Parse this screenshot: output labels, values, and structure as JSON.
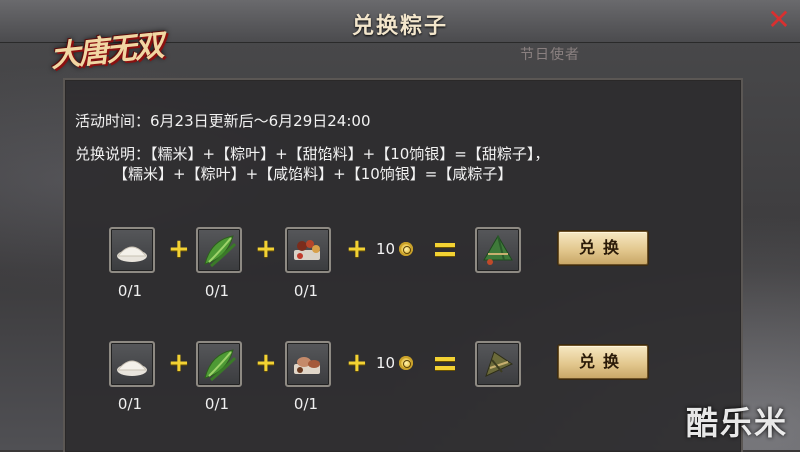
{
  "window": {
    "title": "兑换粽子",
    "close_glyph": "✕",
    "logo_text": "大唐无双",
    "npc_label": "节日使者"
  },
  "info": {
    "time_line": "活动时间：6月23日更新后～6月29日24:00",
    "desc_line1": "兑换说明：【糯米】+【粽叶】+【甜馅料】+【10饷银】=【甜粽子】，",
    "desc_line2": "【糯米】+【粽叶】+【咸馅料】+【10饷银】=【咸粽子】"
  },
  "recipes": [
    {
      "ingredients": [
        {
          "icon": "rice-icon",
          "count": "0/1"
        },
        {
          "icon": "zongzi-leaf-icon",
          "count": "0/1"
        },
        {
          "icon": "sweet-filling-icon",
          "count": "0/1"
        }
      ],
      "plus": "+",
      "cost": "10",
      "result_icon": "sweet-zongzi-icon",
      "button": "兑换"
    },
    {
      "ingredients": [
        {
          "icon": "rice-icon",
          "count": "0/1"
        },
        {
          "icon": "zongzi-leaf-icon",
          "count": "0/1"
        },
        {
          "icon": "savory-filling-icon",
          "count": "0/1"
        }
      ],
      "plus": "+",
      "cost": "10",
      "result_icon": "savory-zongzi-icon",
      "button": "兑换"
    }
  ],
  "watermark": "酷乐米",
  "colors": {
    "accent_yellow": "#f3d233",
    "close_red": "#d83030",
    "title_text": "#f3e6cc",
    "button_fill": "#e3c88f"
  }
}
